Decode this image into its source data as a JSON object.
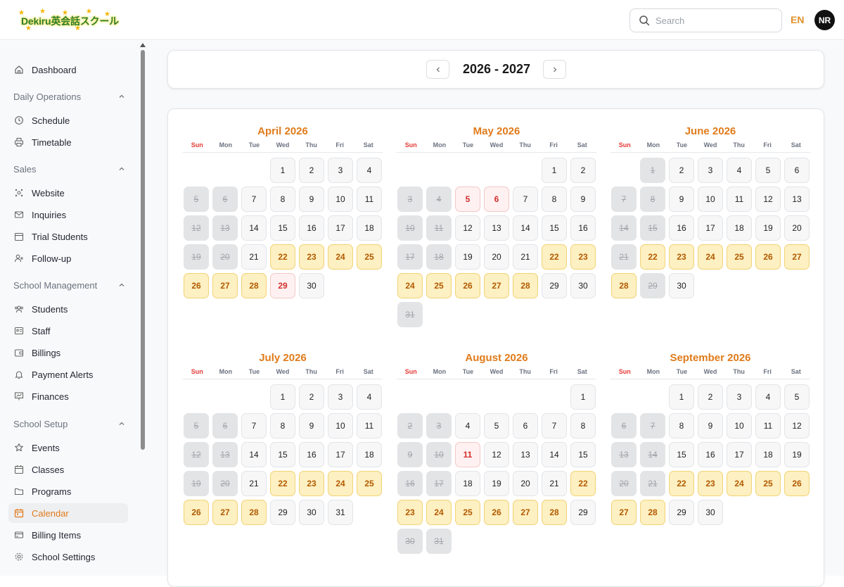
{
  "app": {
    "logo_text": "Dekiru英会話スクール",
    "search_placeholder": "Search",
    "language": "EN",
    "avatar_initials": "NR"
  },
  "sidebar": {
    "dashboard": "Dashboard",
    "sections": {
      "daily": "Daily Operations",
      "sales": "Sales",
      "school_mgmt": "School Management",
      "school_setup": "School Setup"
    },
    "items": {
      "schedule": "Schedule",
      "timetable": "Timetable",
      "website": "Website",
      "inquiries": "Inquiries",
      "trial_students": "Trial Students",
      "follow_up": "Follow-up",
      "students": "Students",
      "staff": "Staff",
      "billings": "Billings",
      "payment_alerts": "Payment Alerts",
      "finances": "Finances",
      "events": "Events",
      "classes": "Classes",
      "programs": "Programs",
      "calendar": "Calendar",
      "billing_items": "Billing Items",
      "school_settings": "School Settings"
    },
    "active": "calendar"
  },
  "calendar": {
    "year_range": "2026 - 2027",
    "weekdays": [
      "Sun",
      "Mon",
      "Tue",
      "Wed",
      "Thu",
      "Fri",
      "Sat"
    ],
    "months": [
      {
        "name": "April 2026",
        "start": 3,
        "days": 30,
        "off": [
          5,
          6,
          12,
          13,
          19,
          20
        ],
        "hl": [
          22,
          23,
          24,
          25,
          26,
          27,
          28
        ],
        "red": [
          29
        ]
      },
      {
        "name": "May 2026",
        "start": 5,
        "days": 31,
        "off": [
          3,
          4,
          10,
          11,
          17,
          18,
          31
        ],
        "hl": [
          22,
          23,
          24,
          25,
          26,
          27,
          28
        ],
        "red": [
          5,
          6
        ]
      },
      {
        "name": "June 2026",
        "start": 1,
        "days": 30,
        "off": [
          1,
          7,
          8,
          14,
          15,
          21,
          29
        ],
        "hl": [
          22,
          23,
          24,
          25,
          26,
          27,
          28
        ],
        "red": []
      },
      {
        "name": "July 2026",
        "start": 3,
        "days": 31,
        "off": [
          5,
          6,
          12,
          13,
          19,
          20
        ],
        "hl": [
          22,
          23,
          24,
          25,
          26,
          27,
          28
        ],
        "red": []
      },
      {
        "name": "August 2026",
        "start": 6,
        "days": 31,
        "off": [
          2,
          3,
          9,
          10,
          16,
          17,
          30,
          31
        ],
        "hl": [
          22,
          23,
          24,
          25,
          26,
          27,
          28
        ],
        "red": [
          11
        ]
      },
      {
        "name": "September 2026",
        "start": 2,
        "days": 30,
        "off": [
          6,
          7,
          13,
          14,
          20,
          21
        ],
        "hl": [
          22,
          23,
          24,
          25,
          26,
          27,
          28
        ],
        "red": []
      }
    ]
  }
}
